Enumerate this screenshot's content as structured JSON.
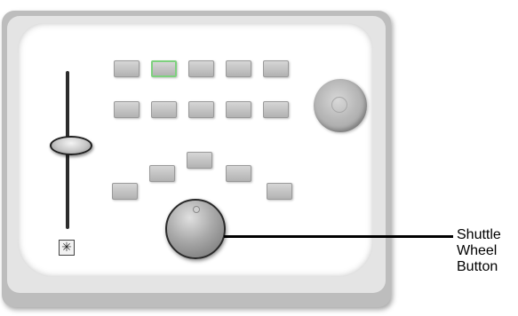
{
  "callout": {
    "label_lines": [
      "Shuttle",
      "Wheel",
      "Button"
    ]
  },
  "controls": {
    "fader_icon": "✳",
    "icons": {
      "fader": "slider-fader-icon",
      "jog": "jog-knob-icon",
      "shuttle": "shuttle-wheel-icon"
    },
    "highlight_color": "#7ed07e"
  }
}
